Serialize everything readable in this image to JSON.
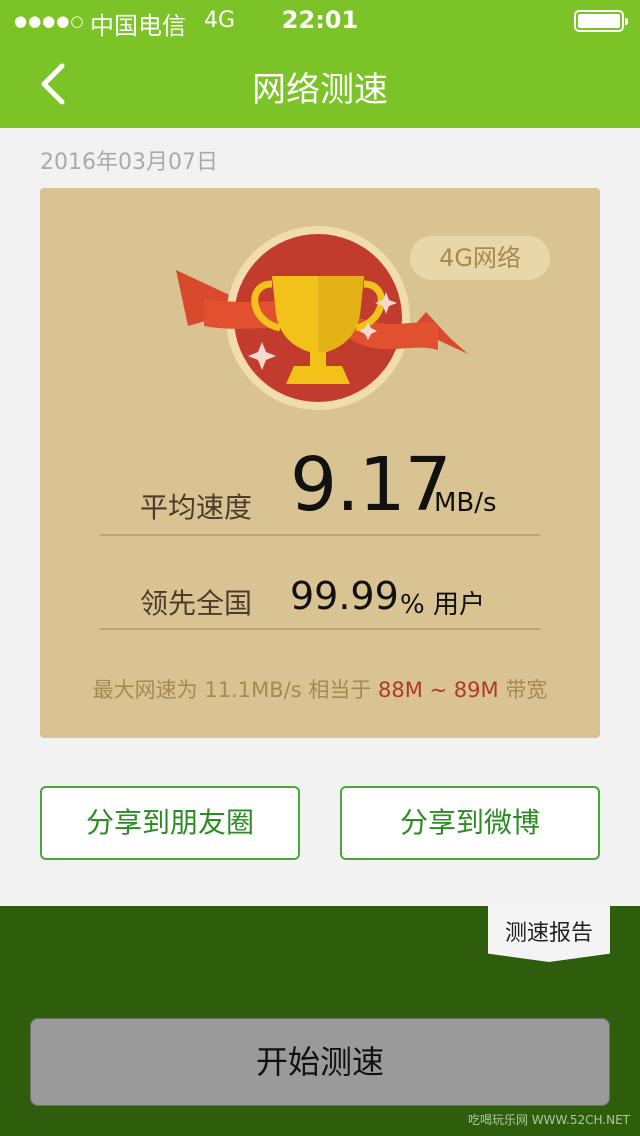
{
  "status_bar": {
    "signal": "●●●●○",
    "carrier": "中国电信",
    "network": "4G",
    "time": "22:01"
  },
  "nav": {
    "title": "网络测速"
  },
  "date": "2016年03月07日",
  "card": {
    "network_badge": "4G网络",
    "avg_label": "平均速度",
    "avg_value": "9.17",
    "avg_unit": "MB/s",
    "rank_label": "领先全国",
    "rank_value": "99.99",
    "rank_unit": "% 用户",
    "max_prefix": "最大网速为 11.1MB/s 相当于 ",
    "max_range": "88M ~ 89M",
    "max_suffix": " 带宽"
  },
  "share": {
    "friends_label": "分享到朋友圈",
    "weibo_label": "分享到微博"
  },
  "bottom": {
    "report_label": "测速报告",
    "start_label": "开始测速"
  },
  "watermark": "吃喝玩乐网 WWW.52CH.NET",
  "colors": {
    "accent": "#7cc328",
    "bottom_bg": "#2e5e0c",
    "card_bg": "#d9c393",
    "highlight_red": "#b03a2a"
  }
}
